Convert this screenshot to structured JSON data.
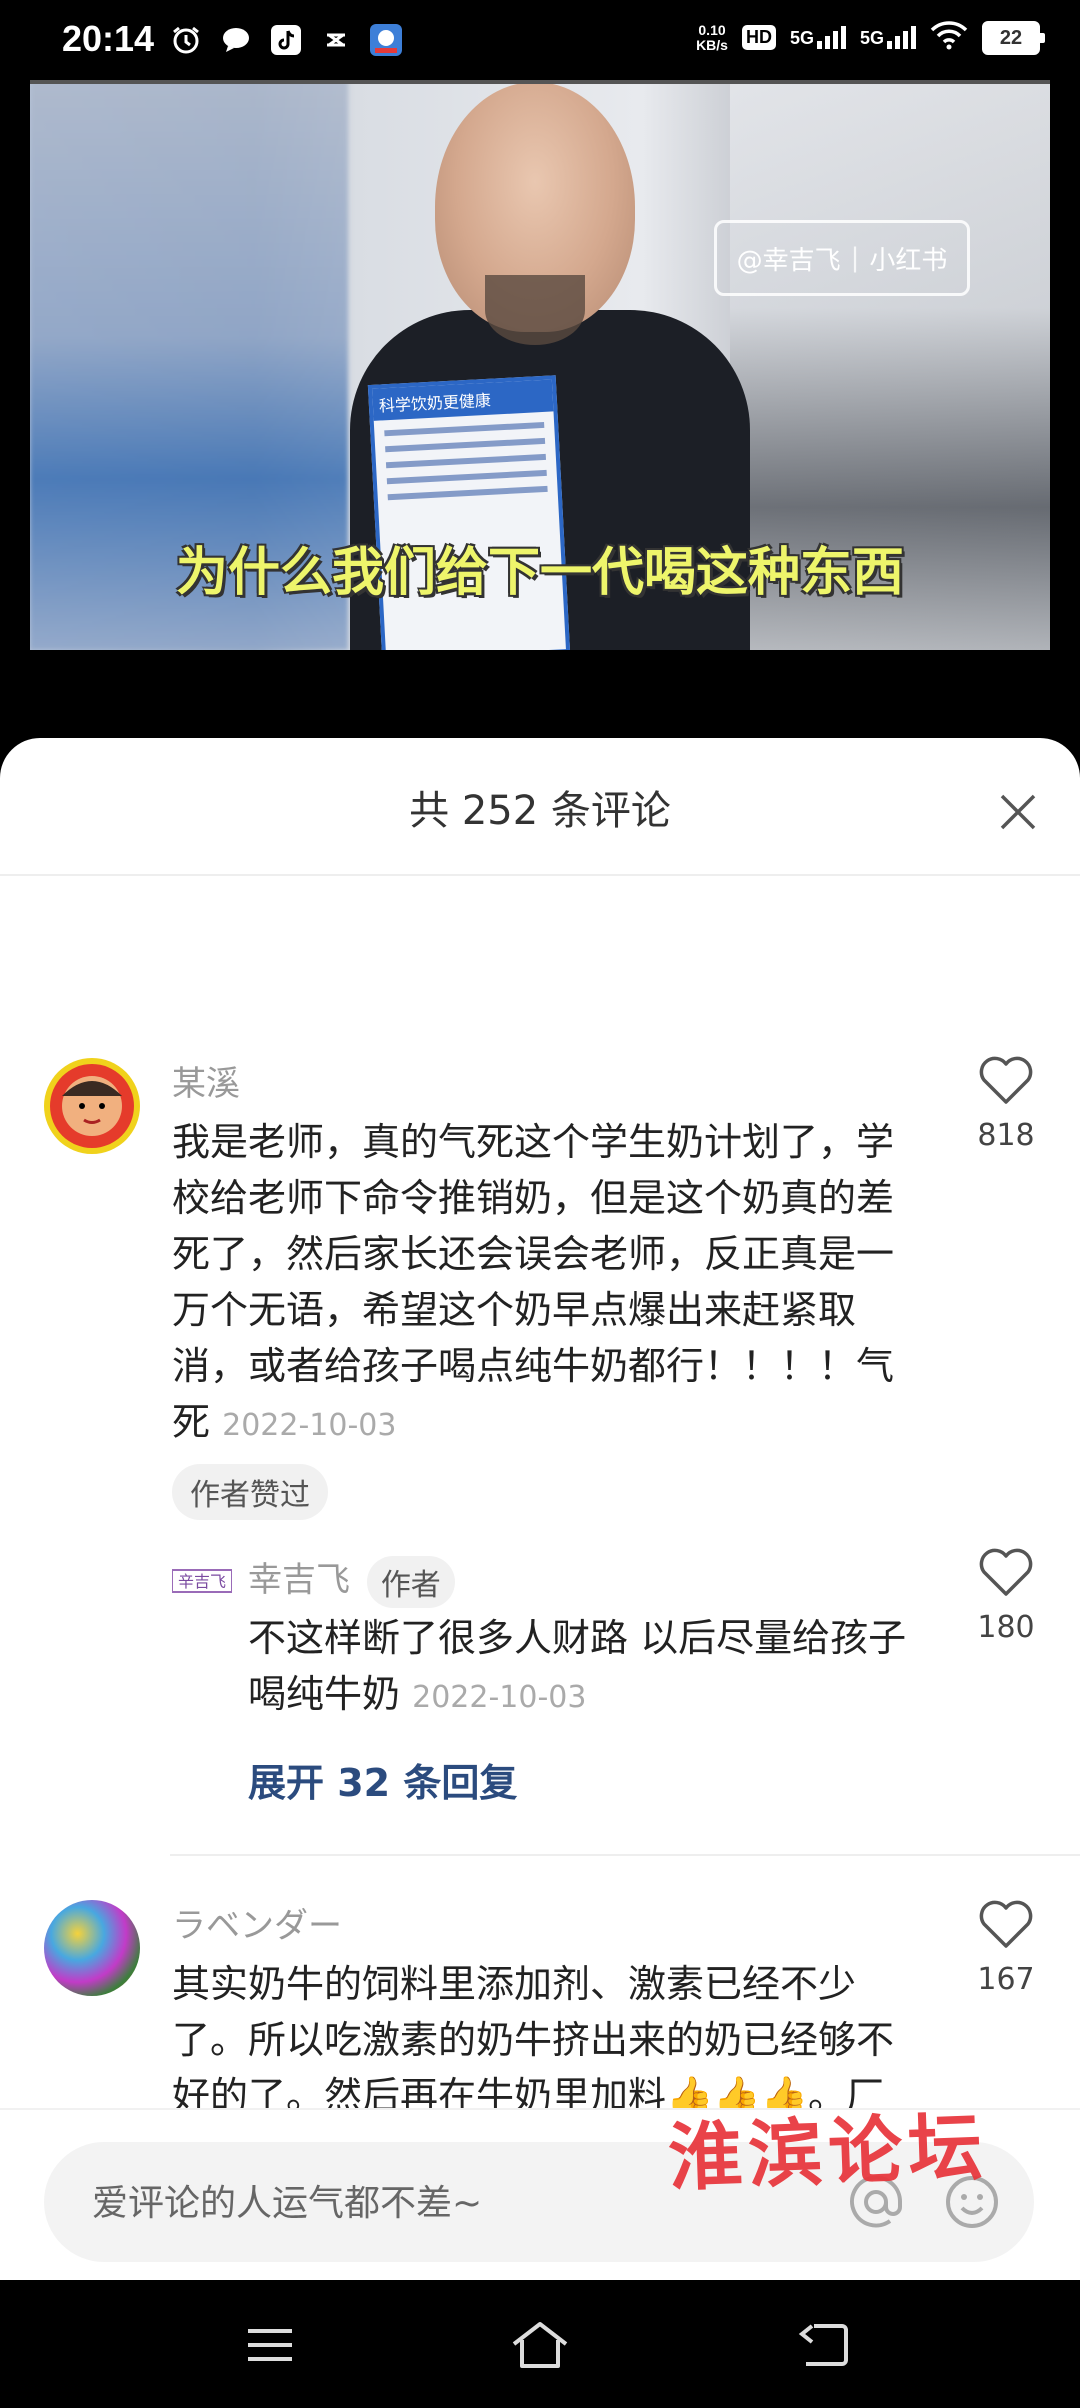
{
  "status_bar": {
    "time": "20:14",
    "net_speed_value": "0.10",
    "net_speed_unit": "KB/s",
    "hd_badge": "HD",
    "signal1_label": "5G",
    "signal2_label": "5G",
    "battery": "22",
    "icons_left": [
      "alarm-icon",
      "chat-bubble-icon",
      "tiktok-icon",
      "app-icon",
      "app-logo-icon"
    ]
  },
  "video": {
    "subtitle": "为什么我们给下一代喝这种东西",
    "watermark_handle": "@幸吉飞",
    "watermark_app": "小红书",
    "carton_header": "科学饮奶更健康"
  },
  "comments_panel": {
    "title": "共 252 条评论",
    "comments": [
      {
        "name": "某溪",
        "text": "我是老师，真的气死这个学生奶计划了，学校给老师下命令推销奶，但是这个奶真的差死了，然后家长还会误会老师，反正真是一万个无语，希望这个奶早点爆出来赶紧取消，或者给孩子喝点纯牛奶都行！！！！气死",
        "date": "2022-10-03",
        "likes": "818",
        "tag": "作者赞过",
        "reply": {
          "name": "幸吉飞",
          "badge": "作者",
          "text": "不这样断了很多人财路 以后尽量给孩子喝纯牛奶",
          "date": "2022-10-03",
          "likes": "180"
        },
        "expand_label": "展开 32 条回复"
      },
      {
        "name": "ラベンダー",
        "text": "其实奶牛的饲料里添加剂、激素已经不少了。所以吃激素的奶牛挤出来的奶已经够不好的了。然后再在牛奶里加料👍👍👍。厂家直接就水加乳化剂、加一大堆添加剂更好、挣得更多。要什么良",
        "likes": "167"
      }
    ]
  },
  "input": {
    "placeholder": "爱评论的人运气都不差~"
  },
  "site_watermark": "淮滨论坛",
  "nav": [
    "menu-icon",
    "home-icon",
    "back-icon"
  ]
}
